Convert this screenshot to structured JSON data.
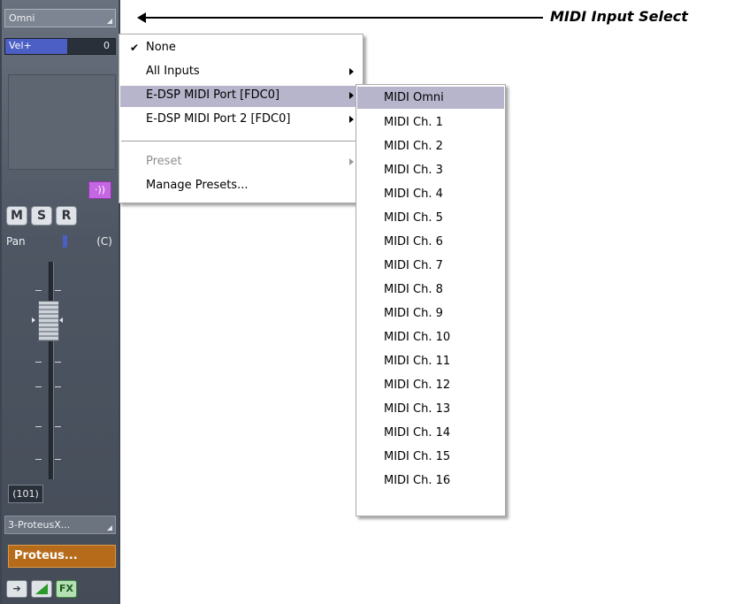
{
  "channel_strip": {
    "input_select_value": "Omni",
    "velocity_label": "Vel+",
    "velocity_value": "0",
    "input_monitor_glyph": "·))",
    "mute_label": "M",
    "solo_label": "S",
    "record_label": "R",
    "pan_label": "Pan",
    "pan_value": "(C)",
    "volume_value": "(101)",
    "output_select_value": "3-ProteusX...",
    "track_name": "Proteus...",
    "fx_label": "FX",
    "icons": [
      "arrow-right-icon",
      "ramp-icon"
    ]
  },
  "callout": {
    "label": "MIDI Input Select"
  },
  "main_menu": {
    "items": [
      {
        "label": "None",
        "checked": true,
        "submenu": false,
        "disabled": false
      },
      {
        "label": "All Inputs",
        "checked": false,
        "submenu": true,
        "disabled": false
      },
      {
        "label": "E-DSP MIDI Port [FDC0]",
        "checked": false,
        "submenu": true,
        "disabled": false,
        "highlighted": true
      },
      {
        "label": "E-DSP MIDI Port 2 [FDC0]",
        "checked": false,
        "submenu": true,
        "disabled": false
      },
      {
        "label": "Preset",
        "checked": false,
        "submenu": true,
        "disabled": true
      },
      {
        "label": "Manage Presets...",
        "checked": false,
        "submenu": false,
        "disabled": false
      }
    ]
  },
  "sub_menu": {
    "items": [
      "MIDI Omni",
      "MIDI Ch. 1",
      "MIDI Ch. 2",
      "MIDI Ch. 3",
      "MIDI Ch. 4",
      "MIDI Ch. 5",
      "MIDI Ch. 6",
      "MIDI Ch. 7",
      "MIDI Ch. 8",
      "MIDI Ch. 9",
      "MIDI Ch. 10",
      "MIDI Ch. 11",
      "MIDI Ch. 12",
      "MIDI Ch. 13",
      "MIDI Ch. 14",
      "MIDI Ch. 15",
      "MIDI Ch. 16"
    ],
    "highlighted": "MIDI Omni"
  },
  "colors": {
    "menu_highlight": "#b7b5cc",
    "velocity_fill": "#4c5fc5",
    "input_monitor": "#c567e3",
    "track_name_bg": "#b56b1a"
  }
}
